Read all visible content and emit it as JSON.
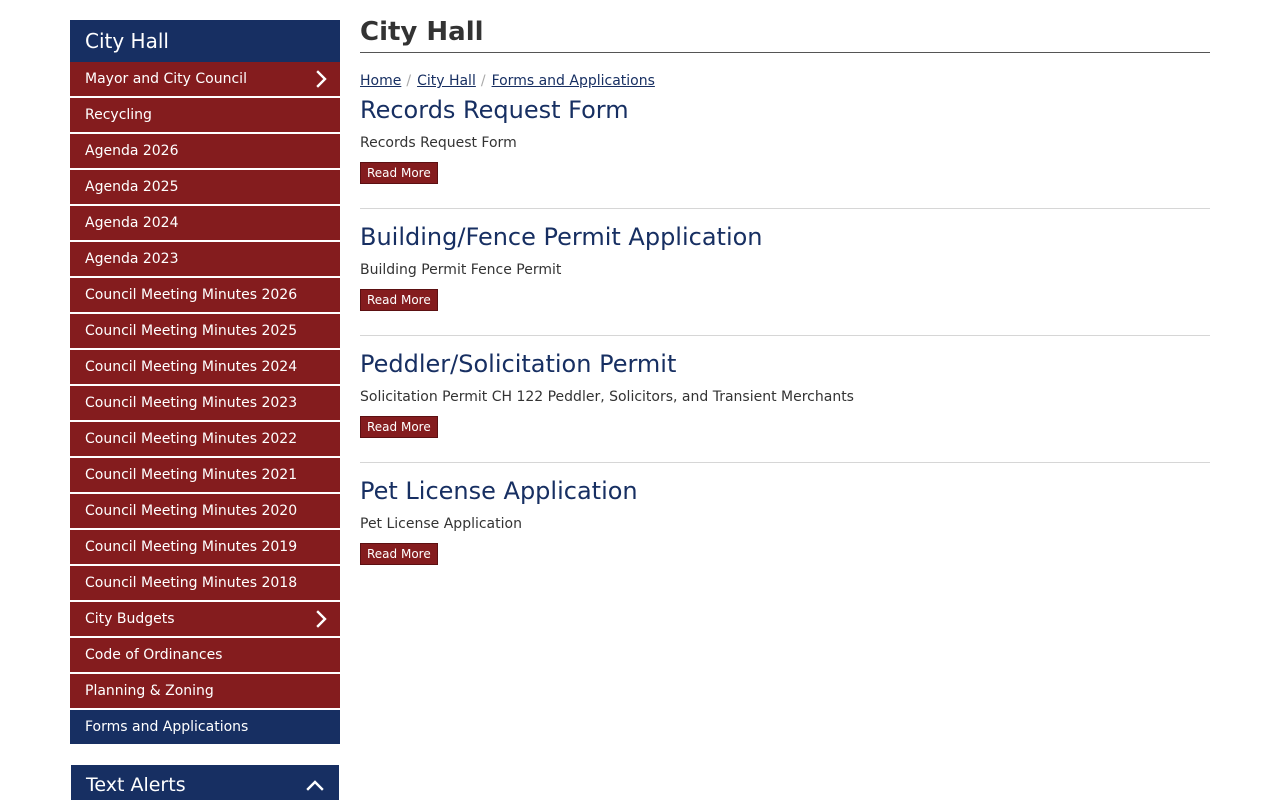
{
  "sidebar": {
    "title": "City Hall",
    "items": [
      {
        "label": "Mayor and City Council",
        "chevron": true
      },
      {
        "label": "Recycling"
      },
      {
        "label": "Agenda 2026"
      },
      {
        "label": "Agenda 2025"
      },
      {
        "label": "Agenda 2024"
      },
      {
        "label": "Agenda 2023"
      },
      {
        "label": "Council Meeting Minutes 2026"
      },
      {
        "label": "Council Meeting Minutes 2025"
      },
      {
        "label": "Council Meeting Minutes 2024"
      },
      {
        "label": "Council Meeting Minutes 2023"
      },
      {
        "label": "Council Meeting Minutes 2022"
      },
      {
        "label": "Council Meeting Minutes 2021"
      },
      {
        "label": "Council Meeting Minutes 2020"
      },
      {
        "label": "Council Meeting Minutes 2019"
      },
      {
        "label": "Council Meeting Minutes 2018"
      },
      {
        "label": "City Budgets",
        "chevron": true
      },
      {
        "label": "Code of Ordinances"
      },
      {
        "label": "Planning & Zoning"
      },
      {
        "label": "Forms and Applications",
        "active": true
      }
    ],
    "alerts_label": "Text Alerts"
  },
  "main": {
    "title": "City Hall",
    "breadcrumb": [
      "Home",
      "City Hall",
      "Forms and Applications"
    ],
    "entries": [
      {
        "title": "Records Request Form",
        "summary": "Records Request Form",
        "button": "Read More"
      },
      {
        "title": "Building/Fence Permit Application",
        "summary": "Building Permit Fence Permit",
        "button": "Read More"
      },
      {
        "title": "Peddler/Solicitation Permit",
        "summary": "Solicitation Permit CH 122 Peddler, Solicitors, and Transient Merchants",
        "button": "Read More"
      },
      {
        "title": "Pet License Application",
        "summary": "Pet License Application",
        "button": "Read More"
      }
    ]
  },
  "colors": {
    "navy": "#172f62",
    "maroon": "#841c1e"
  },
  "icons": {
    "nav_expand": "chevron-right-icon",
    "alerts_toggle": "chevron-up-icon"
  }
}
